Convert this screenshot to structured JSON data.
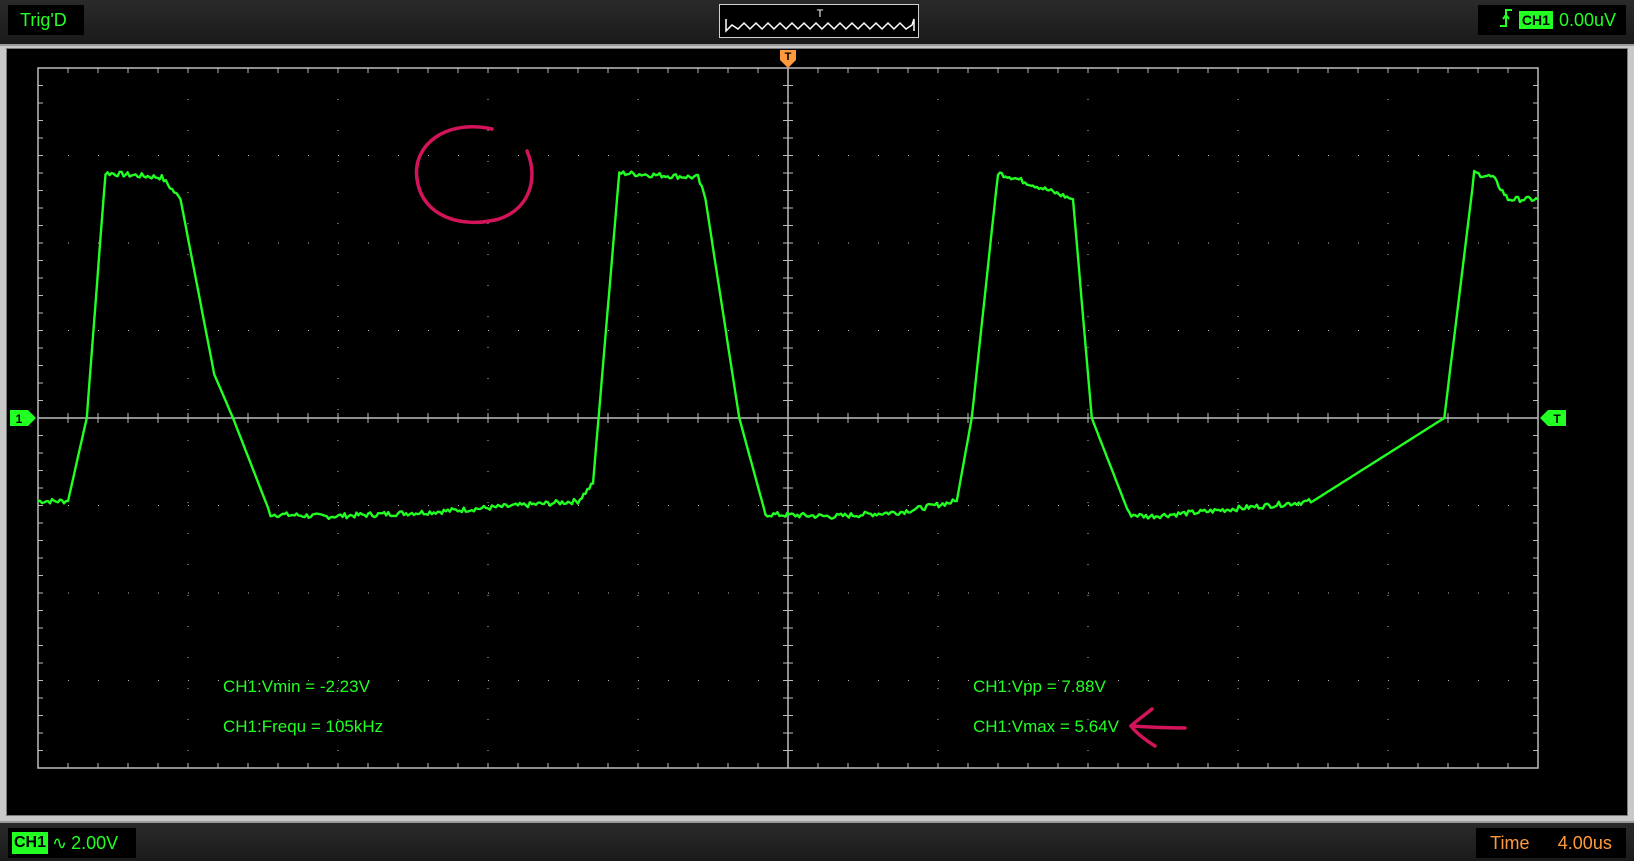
{
  "top_bar": {
    "trigger_status": "Trig'D",
    "overview_marker": "T",
    "trigger_channel": "CH1",
    "trigger_level": "0.00uV",
    "trigger_edge_icon": "rising-edge-icon"
  },
  "screen": {
    "trigger_time_marker": "T",
    "channel_marker": "1",
    "trigger_level_marker": "T",
    "trace_color": "#22ff22",
    "grid_color": "#bdbdbd",
    "measurements": [
      {
        "text": "CH1:Vmin = -2.23V"
      },
      {
        "text": "CH1:Frequ = 105kHz"
      },
      {
        "text": "CH1:Vpp = 7.88V"
      },
      {
        "text": "CH1:Vmax = 5.64V"
      }
    ],
    "annotations": {
      "color": "#d4145a",
      "circle": "highlight-circle",
      "arrow": "pointer-arrow"
    }
  },
  "chart_data": {
    "type": "line",
    "divisions": {
      "x": 10,
      "y": 8
    },
    "volts_per_div": 2.0,
    "time_per_div_us": 4.0,
    "xlim": [
      -20,
      20
    ],
    "ylim": [
      -8,
      8
    ],
    "series": [
      {
        "channel": "CH1",
        "x": [
          -20,
          -19.2,
          -18.7,
          -18.2,
          -16.7,
          -16.2,
          -15.3,
          -14.8,
          -13.8,
          -12.3,
          -9.5,
          -5.6,
          -5.2,
          -4.5,
          -2.4,
          -2.2,
          -1.3,
          -0.6,
          1.2,
          3.0,
          4.5,
          4.9,
          5.6,
          6.0,
          7.6,
          8.1,
          9.1,
          9.6,
          11.0,
          14.0,
          17.5,
          18.3,
          18.8,
          19.2,
          20.0
        ],
        "y": [
          -1.9,
          -1.9,
          0.0,
          5.6,
          5.5,
          5.0,
          1.0,
          0.0,
          -2.2,
          -2.25,
          -2.15,
          -1.9,
          -1.5,
          5.6,
          5.5,
          5.0,
          0.0,
          -2.2,
          -2.25,
          -2.15,
          -1.9,
          0.0,
          5.6,
          5.5,
          5.0,
          0.0,
          -2.2,
          -2.25,
          -2.15,
          -1.9,
          0.0,
          5.6,
          5.5,
          5.0,
          5.0
        ]
      }
    ]
  },
  "bottom_bar": {
    "channel_label": "CH1",
    "coupling_symbol": "∿",
    "volts_per_div": "2.00V",
    "time_label": "Time",
    "time_per_div": "4.00us"
  }
}
